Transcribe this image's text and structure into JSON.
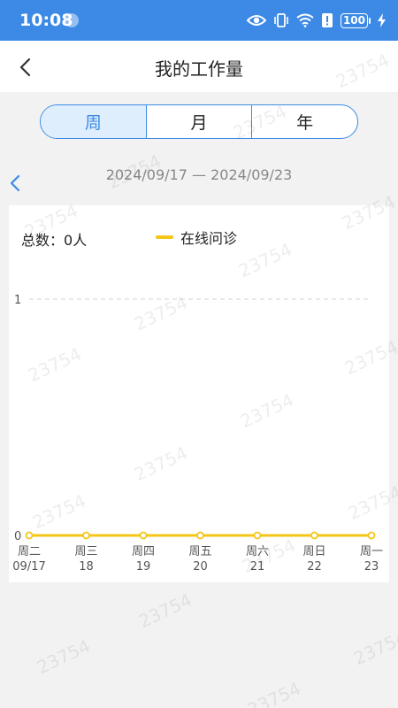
{
  "status_bar": {
    "time": "10:08",
    "battery": "100",
    "icons": [
      "usb-debug-icon",
      "eye-icon",
      "vibrate-icon",
      "wifi-icon",
      "alert-icon",
      "battery-icon",
      "charging-icon"
    ]
  },
  "header": {
    "title": "我的工作量",
    "back_icon": "chevron-left-icon"
  },
  "tabs": [
    {
      "label": "周",
      "active": true
    },
    {
      "label": "月",
      "active": false
    },
    {
      "label": "年",
      "active": false
    }
  ],
  "date_range": {
    "text": "2024/09/17 — 2024/09/23",
    "prev_icon": "chevron-left-icon"
  },
  "summary": {
    "total_label": "总数：",
    "total_value": "0人"
  },
  "legend": {
    "label": "在线问诊",
    "color": "#f5c518"
  },
  "chart_data": {
    "type": "line",
    "categories": [
      "周二\n09/17",
      "周三\n18",
      "周四\n19",
      "周五\n20",
      "周六\n21",
      "周日\n22",
      "周一\n23"
    ],
    "x_weekday": [
      "周二",
      "周三",
      "周四",
      "周五",
      "周六",
      "周日",
      "周一"
    ],
    "x_date": [
      "09/17",
      "18",
      "19",
      "20",
      "21",
      "22",
      "23"
    ],
    "series": [
      {
        "name": "在线问诊",
        "values": [
          0,
          0,
          0,
          0,
          0,
          0,
          0
        ],
        "color": "#f5c518"
      }
    ],
    "y_ticks": [
      0,
      1
    ],
    "ylim": [
      0,
      1
    ],
    "grid": "dashed horizontal"
  },
  "watermark": "23754",
  "colors": {
    "accent": "#3d8ae6",
    "active_tab_bg": "#dfeefc",
    "series": "#f5c518"
  }
}
